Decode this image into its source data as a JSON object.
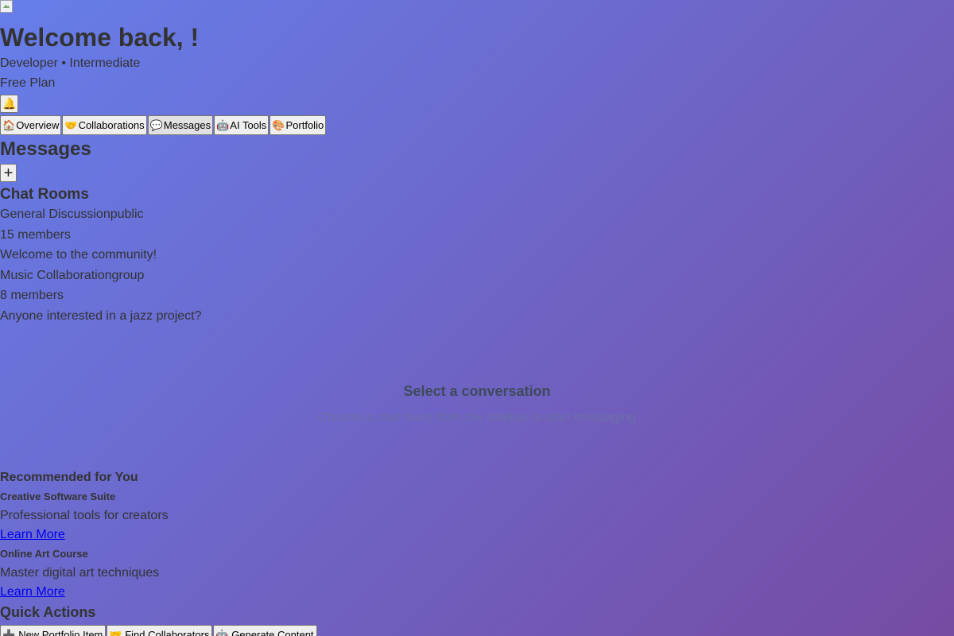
{
  "header": {
    "avatar_icon": "broken-image-icon",
    "welcome_text": "Welcome back, !",
    "role_line": "Developer • Intermediate",
    "plan": "Free Plan",
    "notification_glyph": "🔔"
  },
  "tabs": [
    {
      "icon": "🏠",
      "label": "Overview"
    },
    {
      "icon": "🤝",
      "label": "Collaborations"
    },
    {
      "icon": "💬",
      "label": "Messages"
    },
    {
      "icon": "🤖",
      "label": "AI Tools"
    },
    {
      "icon": "🎨",
      "label": "Portfolio"
    }
  ],
  "active_tab": "Messages",
  "messages": {
    "title": "Messages",
    "new_button_glyph": "+",
    "rooms_title": "Chat Rooms",
    "rooms": [
      {
        "name": "General Discussion",
        "type": "public",
        "members": "15 members",
        "last_message": "Welcome to the community!"
      },
      {
        "name": "Music Collaboration",
        "type": "group",
        "members": "8 members",
        "last_message": "Anyone interested in a jazz project?"
      }
    ],
    "empty_title": "Select a conversation",
    "empty_subtitle": "Choose a chat room from the sidebar to start messaging"
  },
  "recommendations": {
    "title": "Recommended for You",
    "items": [
      {
        "name": "Creative Software Suite",
        "description": "Professional tools for creators",
        "link": "Learn More"
      },
      {
        "name": "Online Art Course",
        "description": "Master digital art techniques",
        "link": "Learn More"
      }
    ]
  },
  "quick_actions": {
    "title": "Quick Actions",
    "buttons": [
      {
        "icon": "➕",
        "label": "New Portfolio Item"
      },
      {
        "icon": "🤝",
        "label": "Find Collaborators"
      },
      {
        "icon": "🤖",
        "label": "Generate Content"
      }
    ]
  },
  "colors": {
    "gradient_start": "#667eea",
    "gradient_end": "#764ba2",
    "text": "#333333",
    "link": "#0000ee"
  }
}
